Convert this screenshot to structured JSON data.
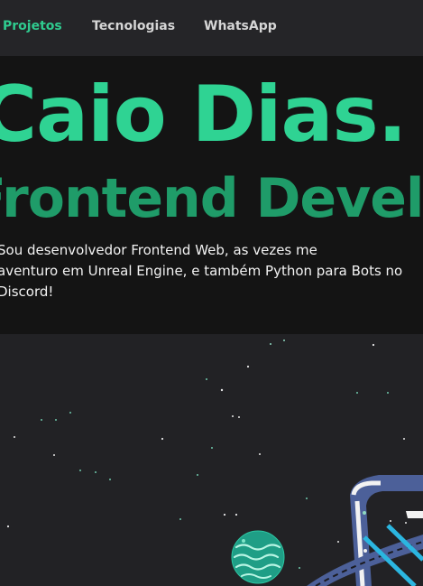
{
  "nav": {
    "items": [
      {
        "label": "Projetos",
        "active": true
      },
      {
        "label": "Tecnologias",
        "active": false
      },
      {
        "label": "WhatsApp",
        "active": false
      }
    ]
  },
  "hero": {
    "name": "Caio Dias.",
    "role": "Frontend Developer",
    "description_lines": [
      "Sou desenvolvedor Frontend Web, as vezes me",
      "aventuro em Unreal Engine, e também Python para Bots no",
      "Discord!"
    ]
  },
  "colors": {
    "accent": "#2fd393",
    "accent_dark": "#1f9c69",
    "nav_bg": "#252528",
    "hero_bg": "#141414",
    "scene_bg": "#222225"
  },
  "scene": {
    "icons": [
      "stars-icon",
      "planet-icon",
      "ring-icon"
    ]
  }
}
